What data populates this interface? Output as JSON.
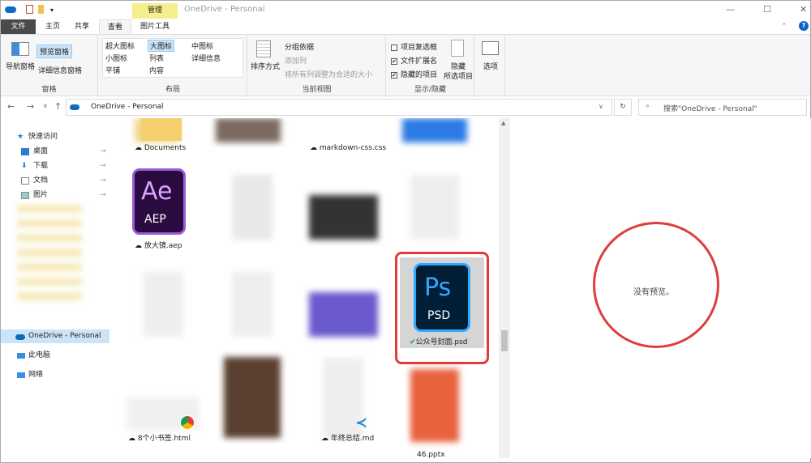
{
  "window": {
    "title": "OneDrive - Personal",
    "context_tab": "管理",
    "minimize": "—",
    "maximize": "☐",
    "close": "✕"
  },
  "tabs": [
    {
      "label": "文件"
    },
    {
      "label": "主页"
    },
    {
      "label": "共享"
    },
    {
      "label": "查看"
    },
    {
      "label": "图片工具"
    }
  ],
  "ribbon": {
    "panes": {
      "nav_pane": "导航窗格",
      "preview_pane": "预览窗格",
      "details_pane": "详细信息窗格",
      "group": "窗格"
    },
    "layout": {
      "items": [
        "超大图标",
        "大图标",
        "中图标",
        "小图标",
        "列表",
        "详细信息",
        "平铺",
        "内容"
      ],
      "selected": "大图标",
      "group": "布局"
    },
    "current_view": {
      "sort": "排序方式",
      "group_by": "分组依据",
      "add_column": "添加列",
      "fit_columns": "将所有列调整为合适的大小",
      "group": "当前视图"
    },
    "show_hide": {
      "item_checkboxes": "项目复选框",
      "item_checkboxes_checked": false,
      "extensions": "文件扩展名",
      "extensions_checked": true,
      "hidden_items": "隐藏的项目",
      "hidden_items_checked": true,
      "hide_selected_1": "隐藏",
      "hide_selected_2": "所选项目",
      "group": "显示/隐藏"
    },
    "options": "选项"
  },
  "address": {
    "path": "OneDrive - Personal",
    "search_placeholder": "搜索\"OneDrive - Personal\""
  },
  "nav": {
    "quick_access": "快速访问",
    "items": [
      "桌面",
      "下载",
      "文档",
      "图片"
    ],
    "onedrive": "OneDrive - Personal",
    "this_pc": "此电脑",
    "network": "网络"
  },
  "files": [
    {
      "name": "Documents"
    },
    {
      "name": "markdown-css.css"
    },
    {
      "name": "放大镜.aep",
      "icon": "Ae",
      "ext": "AEP"
    },
    {
      "name": "公众号封面.psd",
      "icon": "Ps",
      "ext": "PSD"
    },
    {
      "name": "8个小书签.html"
    },
    {
      "name": "年终总结.md"
    },
    {
      "name": "46.pptx"
    }
  ],
  "preview": {
    "message": "没有预览。"
  },
  "colors": {
    "accent": "#0078d7",
    "highlight": "#e03c3c",
    "ae": "#2a0b3f",
    "ae_fg": "#d9a6ff",
    "ps": "#001e36",
    "ps_fg": "#31a8ff"
  }
}
